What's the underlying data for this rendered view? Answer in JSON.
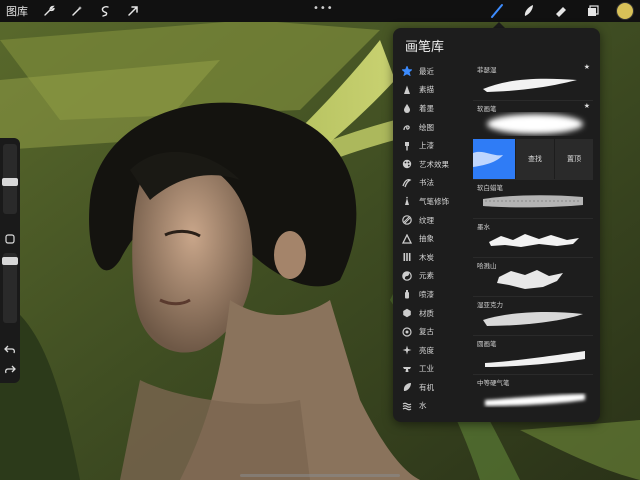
{
  "topbar": {
    "gallery_label": "图库",
    "left_icons": [
      "wrench-icon",
      "magic-wand-icon",
      "selection-icon",
      "transform-arrow-icon"
    ],
    "more_label": "•••",
    "right_icons": [
      "brush-icon",
      "smudge-icon",
      "eraser-icon",
      "layers-icon"
    ],
    "active_color": "#d8c158"
  },
  "sidebar": {
    "icons": [
      "square-modifier-icon",
      "undo-icon",
      "redo-icon"
    ]
  },
  "brush_library": {
    "title": "画笔库",
    "accent_color": "#3d8cff",
    "categories": [
      {
        "label": "最近",
        "icon": "star-icon",
        "active": true
      },
      {
        "label": "素描",
        "icon": "pencil-tip-icon"
      },
      {
        "label": "着墨",
        "icon": "ink-drop-icon"
      },
      {
        "label": "绘图",
        "icon": "swirl-icon"
      },
      {
        "label": "上漆",
        "icon": "paint-brush-icon"
      },
      {
        "label": "艺术效果",
        "icon": "palette-icon"
      },
      {
        "label": "书法",
        "icon": "calligraphy-icon"
      },
      {
        "label": "气笔修饰",
        "icon": "airbrush-icon"
      },
      {
        "label": "纹理",
        "icon": "texture-icon"
      },
      {
        "label": "抽象",
        "icon": "triangle-icon"
      },
      {
        "label": "木炭",
        "icon": "charcoal-icon"
      },
      {
        "label": "元素",
        "icon": "yin-yang-icon"
      },
      {
        "label": "喷漆",
        "icon": "spray-can-icon"
      },
      {
        "label": "材质",
        "icon": "hexagon-icon"
      },
      {
        "label": "复古",
        "icon": "retro-icon"
      },
      {
        "label": "亮度",
        "icon": "sparkle-icon"
      },
      {
        "label": "工业",
        "icon": "anvil-icon"
      },
      {
        "label": "有机",
        "icon": "leaf-icon"
      },
      {
        "label": "水",
        "icon": "waves-icon"
      }
    ],
    "brushes": [
      {
        "name": "菲瑟湿",
        "starred": true
      },
      {
        "name": "软画笔",
        "starred": true
      }
    ],
    "swipe_actions": [
      "查找",
      "置顶"
    ],
    "brushes_after": [
      {
        "name": "软白蜡笔"
      },
      {
        "name": "墨水"
      },
      {
        "name": "哈溅山"
      },
      {
        "name": "湿亚克力"
      },
      {
        "name": "圆画笔"
      },
      {
        "name": "中等硬气笔"
      }
    ]
  }
}
